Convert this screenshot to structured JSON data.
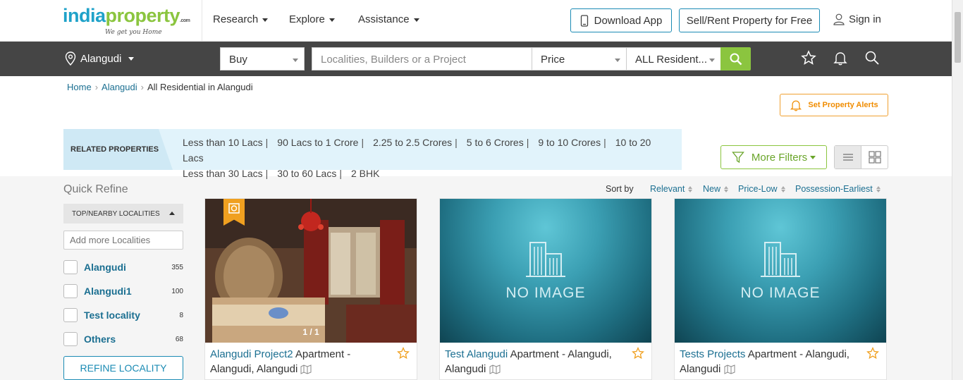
{
  "header": {
    "logo": {
      "part1": "india",
      "part2": "property",
      "suffix": ".com",
      "tagline": "We get you Home"
    },
    "menu": [
      {
        "label": "Research"
      },
      {
        "label": "Explore"
      },
      {
        "label": "Assistance"
      }
    ],
    "download_app": "Download App",
    "sell_rent": "Sell/Rent Property for Free",
    "sign_in": "Sign in"
  },
  "search": {
    "city": "Alangudi",
    "type": "Buy",
    "placeholder": "Localities, Builders or a Project",
    "price": "Price",
    "category": "ALL Resident..."
  },
  "breadcrumb": {
    "home": "Home",
    "city": "Alangudi",
    "current": "All Residential in Alangudi"
  },
  "alerts_button": "Set Property Alerts",
  "related": {
    "label": "RELATED PROPERTIES",
    "links": [
      "Less than 10 Lacs",
      "90 Lacs to 1 Crore",
      "2.25 to 2.5 Crores",
      "5 to 6 Crores",
      "9 to 10 Crores",
      "10 to 20 Lacs",
      "Less than 30 Lacs",
      "30 to 60 Lacs",
      "2 BHK"
    ]
  },
  "more_filters": "More Filters",
  "sidebar": {
    "title": "Quick Refine",
    "section": "TOP/NEARBY LOCALITIES",
    "input_placeholder": "Add more Localities",
    "localities": [
      {
        "name": "Alangudi",
        "count": "355"
      },
      {
        "name": "Alangudi1",
        "count": "100"
      },
      {
        "name": "Test locality",
        "count": "8"
      },
      {
        "name": "Others",
        "count": "68"
      }
    ],
    "refine_button": "REFINE LOCALITY"
  },
  "sort": {
    "label": "Sort by",
    "options": [
      "Relevant",
      "New",
      "Price-Low",
      "Possession-Earliest"
    ]
  },
  "cards": [
    {
      "name": "Alangudi Project2",
      "type": " Apartment -",
      "location": "Alangudi, Alangudi",
      "counter": "1 / 1",
      "no_image": ""
    },
    {
      "name": "Test Alangudi",
      "type": " Apartment - Alangudi,",
      "location": "Alangudi",
      "counter": "",
      "no_image": "NO IMAGE"
    },
    {
      "name": "Tests Projects",
      "type": " Apartment - Alangudi,",
      "location": "Alangudi",
      "counter": "",
      "no_image": "NO IMAGE"
    }
  ],
  "colors": {
    "brand_blue": "#1fa2c9",
    "brand_green": "#8bc53f",
    "dark_bar": "#454545",
    "alert_orange": "#f08c00"
  }
}
